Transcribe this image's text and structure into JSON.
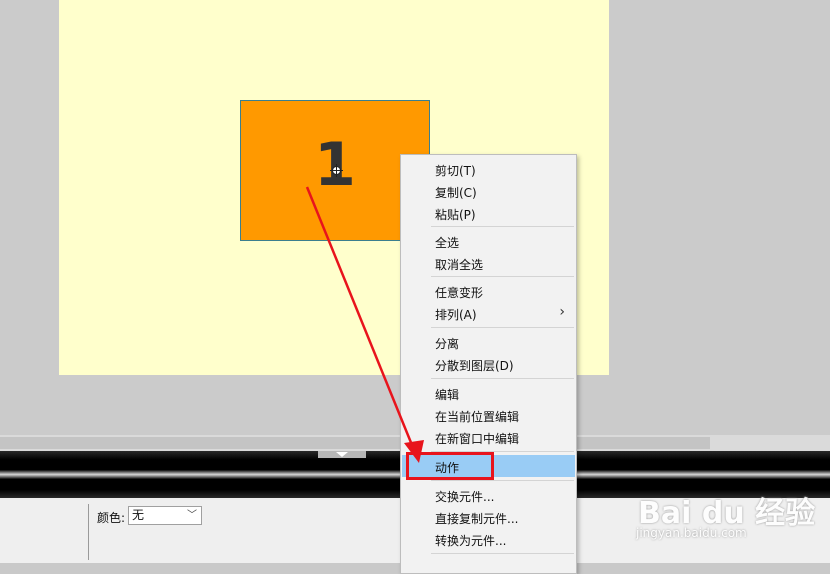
{
  "stage": {
    "symbol_label": "1",
    "colors": {
      "stage_bg": "#ffffcc",
      "symbol_fill": "#ff9900"
    }
  },
  "properties": {
    "color_label": "颜色:",
    "color_value": "无",
    "color_options": [
      "无"
    ]
  },
  "context_menu": {
    "cut": "剪切(T)",
    "copy": "复制(C)",
    "paste": "粘贴(P)",
    "select_all": "全选",
    "deselect_all": "取消全选",
    "free_transform": "任意变形",
    "arrange": "排列(A)",
    "break_apart": "分离",
    "distribute_to_layers": "分散到图层(D)",
    "edit": "编辑",
    "edit_in_place": "在当前位置编辑",
    "edit_in_new_window": "在新窗口中编辑",
    "actions": "动作",
    "swap_symbol": "交换元件...",
    "duplicate_symbol": "直接复制元件...",
    "convert_to_symbol": "转换为元件...",
    "submenu_chevron": "›",
    "highlighted_item": "动作",
    "highlight_color": "#99ccf5"
  },
  "annotation": {
    "color": "#e8141c"
  },
  "watermark": {
    "logo": "Bai du 经验",
    "url": "jingyan.baidu.com"
  }
}
